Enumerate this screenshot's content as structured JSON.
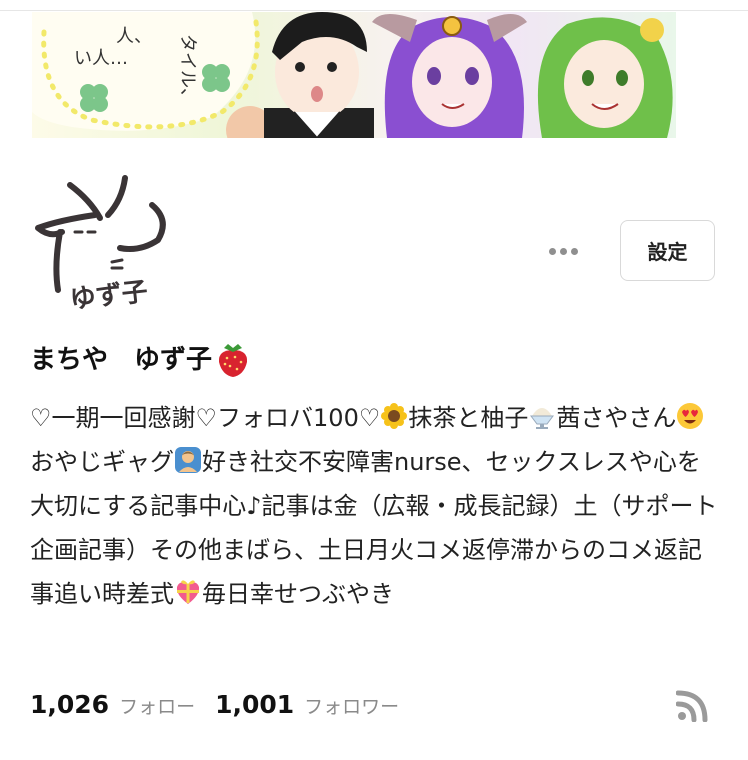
{
  "header_image": {
    "icon": "manga-banner-image",
    "text_fragments": [
      "人、",
      "い人…",
      "タイル、"
    ]
  },
  "profile": {
    "avatar_icon": "rabbit-avatar-icon",
    "avatar_text": "ゆず子",
    "name": "まちや　ゆず子",
    "name_icon": "strawberry-icon",
    "bio_segments": [
      "♡一期一回感謝♡フォロバ100♡",
      "抹茶と柚子",
      "茜さやさん",
      "おやじギャグ",
      "好き社交不安障害nurse、セックスレスや心を大切にする記事中心♪記事は金（広報・成長記録）土（サポート企画記事）その他まばら、土日月火コメ返停滞からのコメ返記事追い時差式",
      "毎日幸せつぶやき"
    ],
    "bio_icons": [
      "sunflower-icon",
      "shaved-ice-icon",
      "heart-eyes-face-icon",
      "person-icon",
      "heart-gift-icon"
    ]
  },
  "actions": {
    "more_icon": "more-dots-icon",
    "settings_label": "設定"
  },
  "stats": {
    "following_count": "1,026",
    "following_label": "フォロー",
    "followers_count": "1,001",
    "followers_label": "フォロワー",
    "rss_icon": "rss-icon"
  }
}
